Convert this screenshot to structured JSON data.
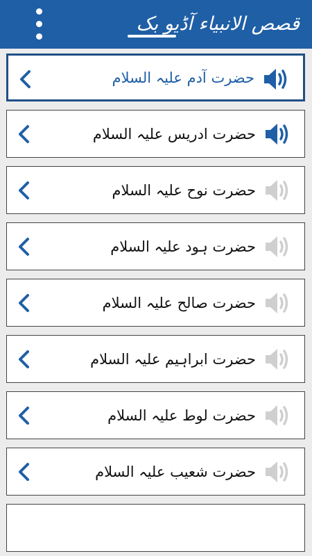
{
  "header": {
    "title": "قصص الانبیاء آڈیو بک",
    "background": "#1f5fa6"
  },
  "items": [
    {
      "label": "حضرت آدم علیہ السلام",
      "selected": true,
      "audio": "active",
      "speaker_color": "#1f5fa6"
    },
    {
      "label": "حضرت ادریس علیہ السلام",
      "selected": false,
      "audio": "active",
      "speaker_color": "#1f5fa6"
    },
    {
      "label": "حضرت نوح علیہ السلام",
      "selected": false,
      "audio": "inactive",
      "speaker_color": "#cfcfcf"
    },
    {
      "label": "حضرت ہود علیہ السلام",
      "selected": false,
      "audio": "inactive",
      "speaker_color": "#cfcfcf"
    },
    {
      "label": "حضرت صالح علیہ السلام",
      "selected": false,
      "audio": "inactive",
      "speaker_color": "#cfcfcf"
    },
    {
      "label": "حضرت ابراہیم علیہ السلام",
      "selected": false,
      "audio": "inactive",
      "speaker_color": "#cfcfcf"
    },
    {
      "label": "حضرت لوط علیہ السلام",
      "selected": false,
      "audio": "inactive",
      "speaker_color": "#cfcfcf"
    },
    {
      "label": "حضرت شعیب علیہ السلام",
      "selected": false,
      "audio": "inactive",
      "speaker_color": "#cfcfcf"
    }
  ],
  "icons": {
    "menu": "overflow-menu-icon",
    "chevron": "chevron-left-icon",
    "speaker": "speaker-icon"
  }
}
